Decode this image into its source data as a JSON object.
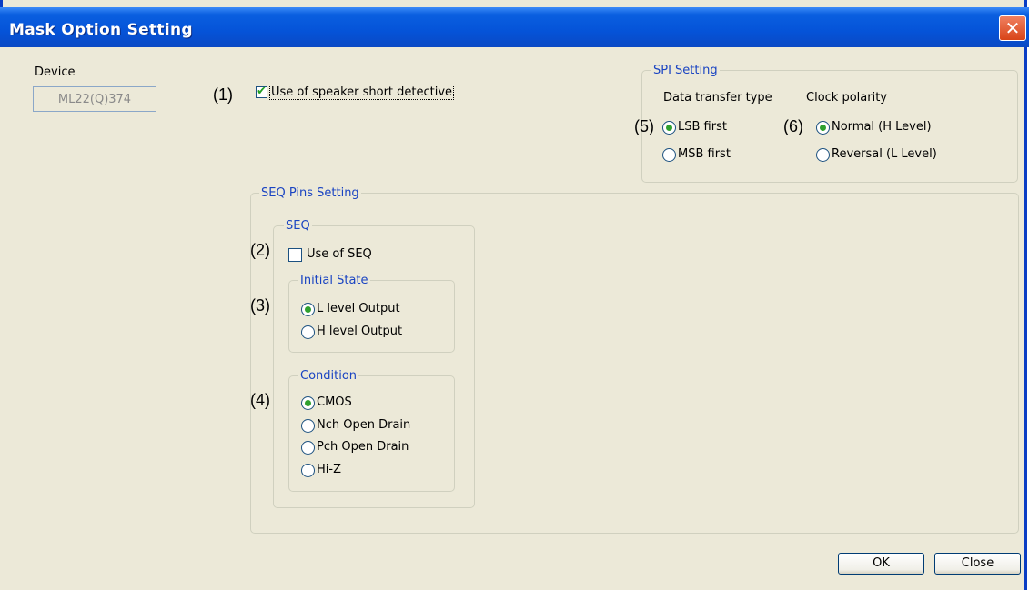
{
  "window": {
    "title": "Mask Option Setting",
    "close_glyph": "✕"
  },
  "device": {
    "label": "Device",
    "value": "ML22(Q)374"
  },
  "speaker": {
    "marker": "(1)",
    "label": "Use of speaker short detective",
    "checked": true
  },
  "spi": {
    "title": "SPI Setting",
    "data_transfer": {
      "label": "Data transfer type",
      "marker": "(5)",
      "options": [
        "LSB first",
        "MSB first"
      ],
      "selected": 0
    },
    "clock_polarity": {
      "label": "Clock polarity",
      "marker": "(6)",
      "options": [
        "Normal (H Level)",
        "Reversal (L Level)"
      ],
      "selected": 0
    }
  },
  "seq_pins": {
    "title": "SEQ Pins Setting",
    "seq": {
      "title": "SEQ",
      "use": {
        "marker": "(2)",
        "label": "Use of SEQ",
        "checked": false
      },
      "initial_state": {
        "title": "Initial State",
        "marker": "(3)",
        "options": [
          "L level Output",
          "H level Output"
        ],
        "selected": 0
      },
      "condition": {
        "title": "Condition",
        "marker": "(4)",
        "options": [
          "CMOS",
          "Nch Open Drain",
          "Pch Open Drain",
          "Hi-Z"
        ],
        "selected": 0
      }
    }
  },
  "buttons": {
    "ok": "OK",
    "close": "Close"
  },
  "colors": {
    "title_bar": "#0553d8",
    "group_title": "#1a44c2",
    "radio_dot": "#2fa02f",
    "face": "#ece9d8"
  }
}
